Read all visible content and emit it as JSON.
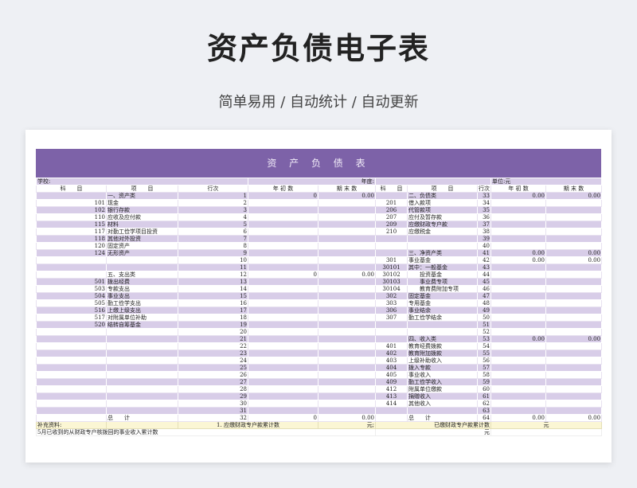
{
  "page": {
    "title": "资产负债电子表",
    "subtitle": "简单易用  /  自动统计  /  自动更新"
  },
  "sheet": {
    "banner_title": "资 产 负 债 表",
    "header_row": {
      "school_label": "学校:",
      "year_label": "年度:",
      "unit_label": "单位:元"
    },
    "columns": [
      "科　　目",
      "项　　目",
      "行次",
      "年 初 数",
      "期 末 数",
      "科　　目",
      "项　　目",
      "行次",
      "年 初 数",
      "期 末 数"
    ],
    "rows": [
      [
        "",
        "一、资产类",
        "1",
        "0",
        "0.00",
        "",
        "二、负债类",
        "33",
        "0.00",
        "0.00"
      ],
      [
        "101",
        "现金",
        "2",
        "",
        "",
        "201",
        "借入款项",
        "34",
        "",
        ""
      ],
      [
        "102",
        "银行存款",
        "3",
        "",
        "",
        "206",
        "代管款项",
        "35",
        "",
        ""
      ],
      [
        "110",
        "应收及应付款",
        "4",
        "",
        "",
        "207",
        "应付及暂存款",
        "36",
        "",
        ""
      ],
      [
        "115",
        "材料",
        "5",
        "",
        "",
        "209",
        "应缴财政专户款",
        "37",
        "",
        ""
      ],
      [
        "117",
        "对勤工俭学项目投资",
        "6",
        "",
        "",
        "210",
        "应缴税金",
        "38",
        "",
        ""
      ],
      [
        "118",
        "其他对外投资",
        "7",
        "",
        "",
        "",
        "",
        "39",
        "",
        ""
      ],
      [
        "120",
        "固定资产",
        "8",
        "",
        "",
        "",
        "",
        "40",
        "",
        ""
      ],
      [
        "124",
        "无形资产",
        "9",
        "",
        "",
        "",
        "三、净资产类",
        "41",
        "0.00",
        "0.00"
      ],
      [
        "",
        "",
        "10",
        "",
        "",
        "301",
        "事业基金",
        "42",
        "0.00",
        "0.00"
      ],
      [
        "",
        "",
        "11",
        "",
        "",
        "30101",
        "其中：一般基金",
        "43",
        "",
        ""
      ],
      [
        "",
        "五、支出类",
        "12",
        "0",
        "0.00",
        "30102",
        "　　投资基金",
        "44",
        "",
        ""
      ],
      [
        "501",
        "拨出经费",
        "13",
        "",
        "",
        "30103",
        "　　事业费专项",
        "45",
        "",
        ""
      ],
      [
        "503",
        "专款支出",
        "14",
        "",
        "",
        "30104",
        "　　教育费附加专项",
        "46",
        "",
        ""
      ],
      [
        "504",
        "事业支出",
        "15",
        "",
        "",
        "302",
        "固定基金",
        "47",
        "",
        ""
      ],
      [
        "505",
        "勤工俭学支出",
        "16",
        "",
        "",
        "303",
        "专用基金",
        "48",
        "",
        ""
      ],
      [
        "516",
        "上缴上级支出",
        "17",
        "",
        "",
        "306",
        "事业结余",
        "49",
        "",
        ""
      ],
      [
        "517",
        "对附属单位补助",
        "18",
        "",
        "",
        "307",
        "勤工俭学结余",
        "50",
        "",
        ""
      ],
      [
        "520",
        "结转自筹基金",
        "19",
        "",
        "",
        "",
        "",
        "51",
        "",
        ""
      ],
      [
        "",
        "",
        "20",
        "",
        "",
        "",
        "",
        "52",
        "",
        ""
      ],
      [
        "",
        "",
        "21",
        "",
        "",
        "",
        "四、收入类",
        "53",
        "0.00",
        "0.00"
      ],
      [
        "",
        "",
        "22",
        "",
        "",
        "401",
        "教育经费拨款",
        "54",
        "",
        ""
      ],
      [
        "",
        "",
        "23",
        "",
        "",
        "402",
        "教育附加拨款",
        "55",
        "",
        ""
      ],
      [
        "",
        "",
        "24",
        "",
        "",
        "403",
        "上级补助收入",
        "56",
        "",
        ""
      ],
      [
        "",
        "",
        "25",
        "",
        "",
        "404",
        "拨入专款",
        "57",
        "",
        ""
      ],
      [
        "",
        "",
        "26",
        "",
        "",
        "405",
        "事业收入",
        "58",
        "",
        ""
      ],
      [
        "",
        "",
        "27",
        "",
        "",
        "409",
        "勤工俭学收入",
        "59",
        "",
        ""
      ],
      [
        "",
        "",
        "28",
        "",
        "",
        "412",
        "附属单位缴款",
        "60",
        "",
        ""
      ],
      [
        "",
        "",
        "29",
        "",
        "",
        "413",
        "捐赠收入",
        "61",
        "",
        ""
      ],
      [
        "",
        "",
        "30",
        "",
        "",
        "414",
        "其他收入",
        "62",
        "",
        ""
      ],
      [
        "",
        "",
        "31",
        "",
        "",
        "",
        "",
        "63",
        "",
        ""
      ],
      [
        "",
        "总　　计",
        "32",
        "0",
        "0.00",
        "",
        "总　　计",
        "64",
        "0.00",
        "0.00"
      ]
    ],
    "footer": {
      "supplement_label": "补充资料:",
      "item1": "1. 应缴财政专户款累计数",
      "yuan1": "元;",
      "item2": "已缴财政专户款累计数",
      "yuan2": "元",
      "note": "5月已收到的从财政专户核拨回的事业收入累计数",
      "yuan3": "元"
    }
  },
  "colors": {
    "banner": "#7d62a8",
    "row_tint": "#d8cde8",
    "footer_tint": "#fbf6d4"
  }
}
